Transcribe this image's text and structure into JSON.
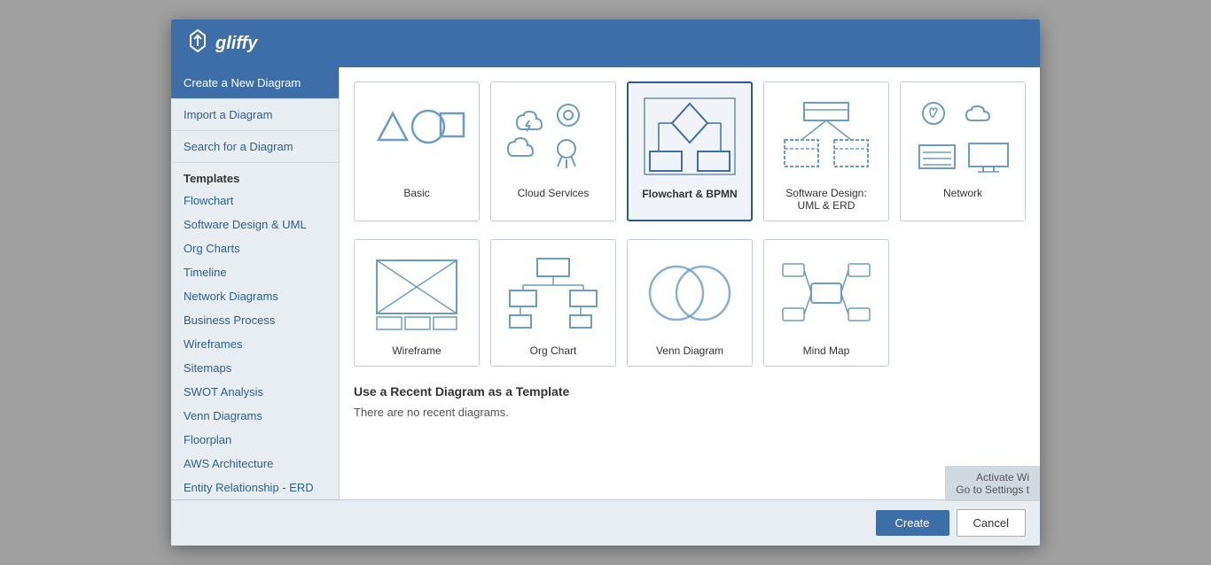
{
  "header": {
    "logo_text": "gliffy"
  },
  "sidebar": {
    "nav_items": [
      {
        "label": "Create a New Diagram",
        "active": true
      },
      {
        "label": "Import a Diagram",
        "active": false
      },
      {
        "label": "Search for a Diagram",
        "active": false
      }
    ],
    "section_label": "Templates",
    "sub_items": [
      "Flowchart",
      "Software Design & UML",
      "Org Charts",
      "Timeline",
      "Network Diagrams",
      "Business Process",
      "Wireframes",
      "Sitemaps",
      "SWOT Analysis",
      "Venn Diagrams",
      "Floorplan",
      "AWS Architecture",
      "Entity Relationship - ERD"
    ]
  },
  "main": {
    "row1": [
      {
        "id": "basic",
        "label": "Basic"
      },
      {
        "id": "cloud",
        "label": "Cloud Services"
      },
      {
        "id": "flowchart",
        "label": "Flowchart & BPMN",
        "selected": true
      },
      {
        "id": "software",
        "label": "Software Design: UML & ERD"
      },
      {
        "id": "network",
        "label": "Network"
      }
    ],
    "row2": [
      {
        "id": "wireframe",
        "label": "Wireframe"
      },
      {
        "id": "orgchart",
        "label": "Org Chart"
      },
      {
        "id": "venn",
        "label": "Venn Diagram"
      },
      {
        "id": "mindmap",
        "label": "Mind Map"
      }
    ],
    "recent_title": "Use a Recent Diagram as a Template",
    "recent_empty": "There are no recent diagrams."
  },
  "footer": {
    "create_label": "Create",
    "cancel_label": "Cancel"
  },
  "watermark": {
    "line1": "Activate Wi",
    "line2": "Go to Settings t"
  }
}
